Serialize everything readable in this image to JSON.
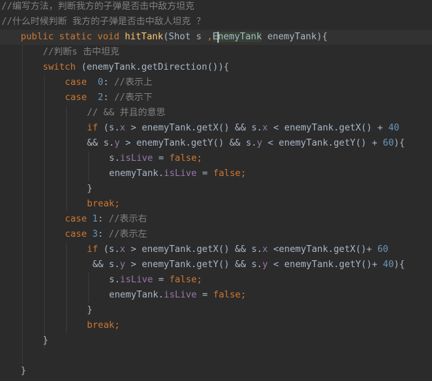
{
  "editor": {
    "lines": [
      {
        "indent": 2,
        "tokens": [
          {
            "t": "//编写方法，判断我方的子弹是否击中敌方坦克",
            "c": "cm"
          }
        ]
      },
      {
        "indent": 2,
        "tokens": [
          {
            "t": "//什么时候判断 我方的子弹是否击中敌人坦克 ？",
            "c": "cm"
          }
        ]
      },
      {
        "indent": 30,
        "current": true,
        "tokens": [
          {
            "t": "public static void ",
            "c": "kw"
          },
          {
            "t": "hitTank",
            "c": "fn"
          },
          {
            "t": "(Shot s ",
            "c": "plain"
          },
          {
            "t": ",",
            "c": "kw"
          },
          {
            "t": "EnemyTank",
            "c": "plain",
            "hl": true
          },
          {
            "t": " enemyTank){",
            "c": "plain"
          }
        ]
      },
      {
        "indent": 62,
        "tokens": [
          {
            "t": "//判断s 击中坦克",
            "c": "cm"
          }
        ]
      },
      {
        "indent": 62,
        "tokens": [
          {
            "t": "switch ",
            "c": "kw"
          },
          {
            "t": "(enemyTank.getDirection()){",
            "c": "plain"
          }
        ]
      },
      {
        "indent": 94,
        "tokens": [
          {
            "t": "case  ",
            "c": "kw"
          },
          {
            "t": "0",
            "c": "num"
          },
          {
            "t": ": ",
            "c": "plain"
          },
          {
            "t": "//表示上",
            "c": "cm"
          }
        ]
      },
      {
        "indent": 94,
        "tokens": [
          {
            "t": "case  ",
            "c": "kw"
          },
          {
            "t": "2",
            "c": "num"
          },
          {
            "t": ": ",
            "c": "plain"
          },
          {
            "t": "//表示下",
            "c": "cm"
          }
        ]
      },
      {
        "indent": 126,
        "tokens": [
          {
            "t": "// && 并且的意思",
            "c": "cm"
          }
        ]
      },
      {
        "indent": 126,
        "tokens": [
          {
            "t": "if ",
            "c": "kw"
          },
          {
            "t": "(s.",
            "c": "plain"
          },
          {
            "t": "x",
            "c": "fld"
          },
          {
            "t": " > enemyTank.getX() && s.",
            "c": "plain"
          },
          {
            "t": "x",
            "c": "fld"
          },
          {
            "t": " < enemyTank.getX() + ",
            "c": "plain"
          },
          {
            "t": "40",
            "c": "num"
          }
        ]
      },
      {
        "indent": 126,
        "tokens": [
          {
            "t": "&& s.",
            "c": "plain"
          },
          {
            "t": "y",
            "c": "fld"
          },
          {
            "t": " > enemyTank.getY() && s.",
            "c": "plain"
          },
          {
            "t": "y",
            "c": "fld"
          },
          {
            "t": " < enemyTank.getY() + ",
            "c": "plain"
          },
          {
            "t": "60",
            "c": "num"
          },
          {
            "t": "){",
            "c": "plain"
          }
        ]
      },
      {
        "indent": 158,
        "tokens": [
          {
            "t": "s.",
            "c": "plain"
          },
          {
            "t": "isLive",
            "c": "fld"
          },
          {
            "t": " = ",
            "c": "plain"
          },
          {
            "t": "false",
            "c": "kw"
          },
          {
            "t": ";",
            "c": "kw"
          }
        ]
      },
      {
        "indent": 158,
        "tokens": [
          {
            "t": "enemyTank.",
            "c": "plain"
          },
          {
            "t": "isLive",
            "c": "fld"
          },
          {
            "t": " = ",
            "c": "plain"
          },
          {
            "t": "false",
            "c": "kw"
          },
          {
            "t": ";",
            "c": "kw"
          }
        ]
      },
      {
        "indent": 126,
        "tokens": [
          {
            "t": "}",
            "c": "plain"
          }
        ]
      },
      {
        "indent": 126,
        "tokens": [
          {
            "t": "break;",
            "c": "kw"
          }
        ]
      },
      {
        "indent": 94,
        "tokens": [
          {
            "t": "case ",
            "c": "kw"
          },
          {
            "t": "1",
            "c": "num"
          },
          {
            "t": ": ",
            "c": "plain"
          },
          {
            "t": "//表示右",
            "c": "cm"
          }
        ]
      },
      {
        "indent": 94,
        "tokens": [
          {
            "t": "case ",
            "c": "kw"
          },
          {
            "t": "3",
            "c": "num"
          },
          {
            "t": ": ",
            "c": "plain"
          },
          {
            "t": "//表示左",
            "c": "cm"
          }
        ]
      },
      {
        "indent": 126,
        "tokens": [
          {
            "t": "if ",
            "c": "kw"
          },
          {
            "t": "(s.",
            "c": "plain"
          },
          {
            "t": "x",
            "c": "fld"
          },
          {
            "t": " > enemyTank.getX() && s.",
            "c": "plain"
          },
          {
            "t": "x",
            "c": "fld"
          },
          {
            "t": " <enemyTank.getX()+ ",
            "c": "plain"
          },
          {
            "t": "60",
            "c": "num"
          }
        ]
      },
      {
        "indent": 126,
        "tokens": [
          {
            "t": " && s.",
            "c": "plain"
          },
          {
            "t": "y",
            "c": "fld"
          },
          {
            "t": " > enemyTank.getY() && s.",
            "c": "plain"
          },
          {
            "t": "y",
            "c": "fld"
          },
          {
            "t": " < enemyTank.getY()+ ",
            "c": "plain"
          },
          {
            "t": "40",
            "c": "num"
          },
          {
            "t": "){",
            "c": "plain"
          }
        ]
      },
      {
        "indent": 158,
        "tokens": [
          {
            "t": "s.",
            "c": "plain"
          },
          {
            "t": "isLive",
            "c": "fld"
          },
          {
            "t": " = ",
            "c": "plain"
          },
          {
            "t": "false",
            "c": "kw"
          },
          {
            "t": ";",
            "c": "kw"
          }
        ]
      },
      {
        "indent": 158,
        "tokens": [
          {
            "t": "enemyTank.",
            "c": "plain"
          },
          {
            "t": "isLive",
            "c": "fld"
          },
          {
            "t": " = ",
            "c": "plain"
          },
          {
            "t": "false",
            "c": "kw"
          },
          {
            "t": ";",
            "c": "kw"
          }
        ]
      },
      {
        "indent": 126,
        "tokens": [
          {
            "t": "}",
            "c": "plain"
          }
        ]
      },
      {
        "indent": 126,
        "tokens": [
          {
            "t": "break;",
            "c": "kw"
          }
        ]
      },
      {
        "indent": 62,
        "tokens": [
          {
            "t": "}",
            "c": "plain"
          }
        ]
      },
      {
        "indent": 30,
        "tokens": []
      },
      {
        "indent": 30,
        "tokens": [
          {
            "t": "}",
            "c": "plain"
          }
        ]
      }
    ]
  },
  "colors": {
    "background": "#2b2b2b",
    "current_line": "#323232",
    "keyword": "#cc7832",
    "function": "#ffc66d",
    "comment": "#808080",
    "number": "#6897bb",
    "field": "#9876aa",
    "plain": "#a9b7c6",
    "usage_highlight": "#344134"
  }
}
